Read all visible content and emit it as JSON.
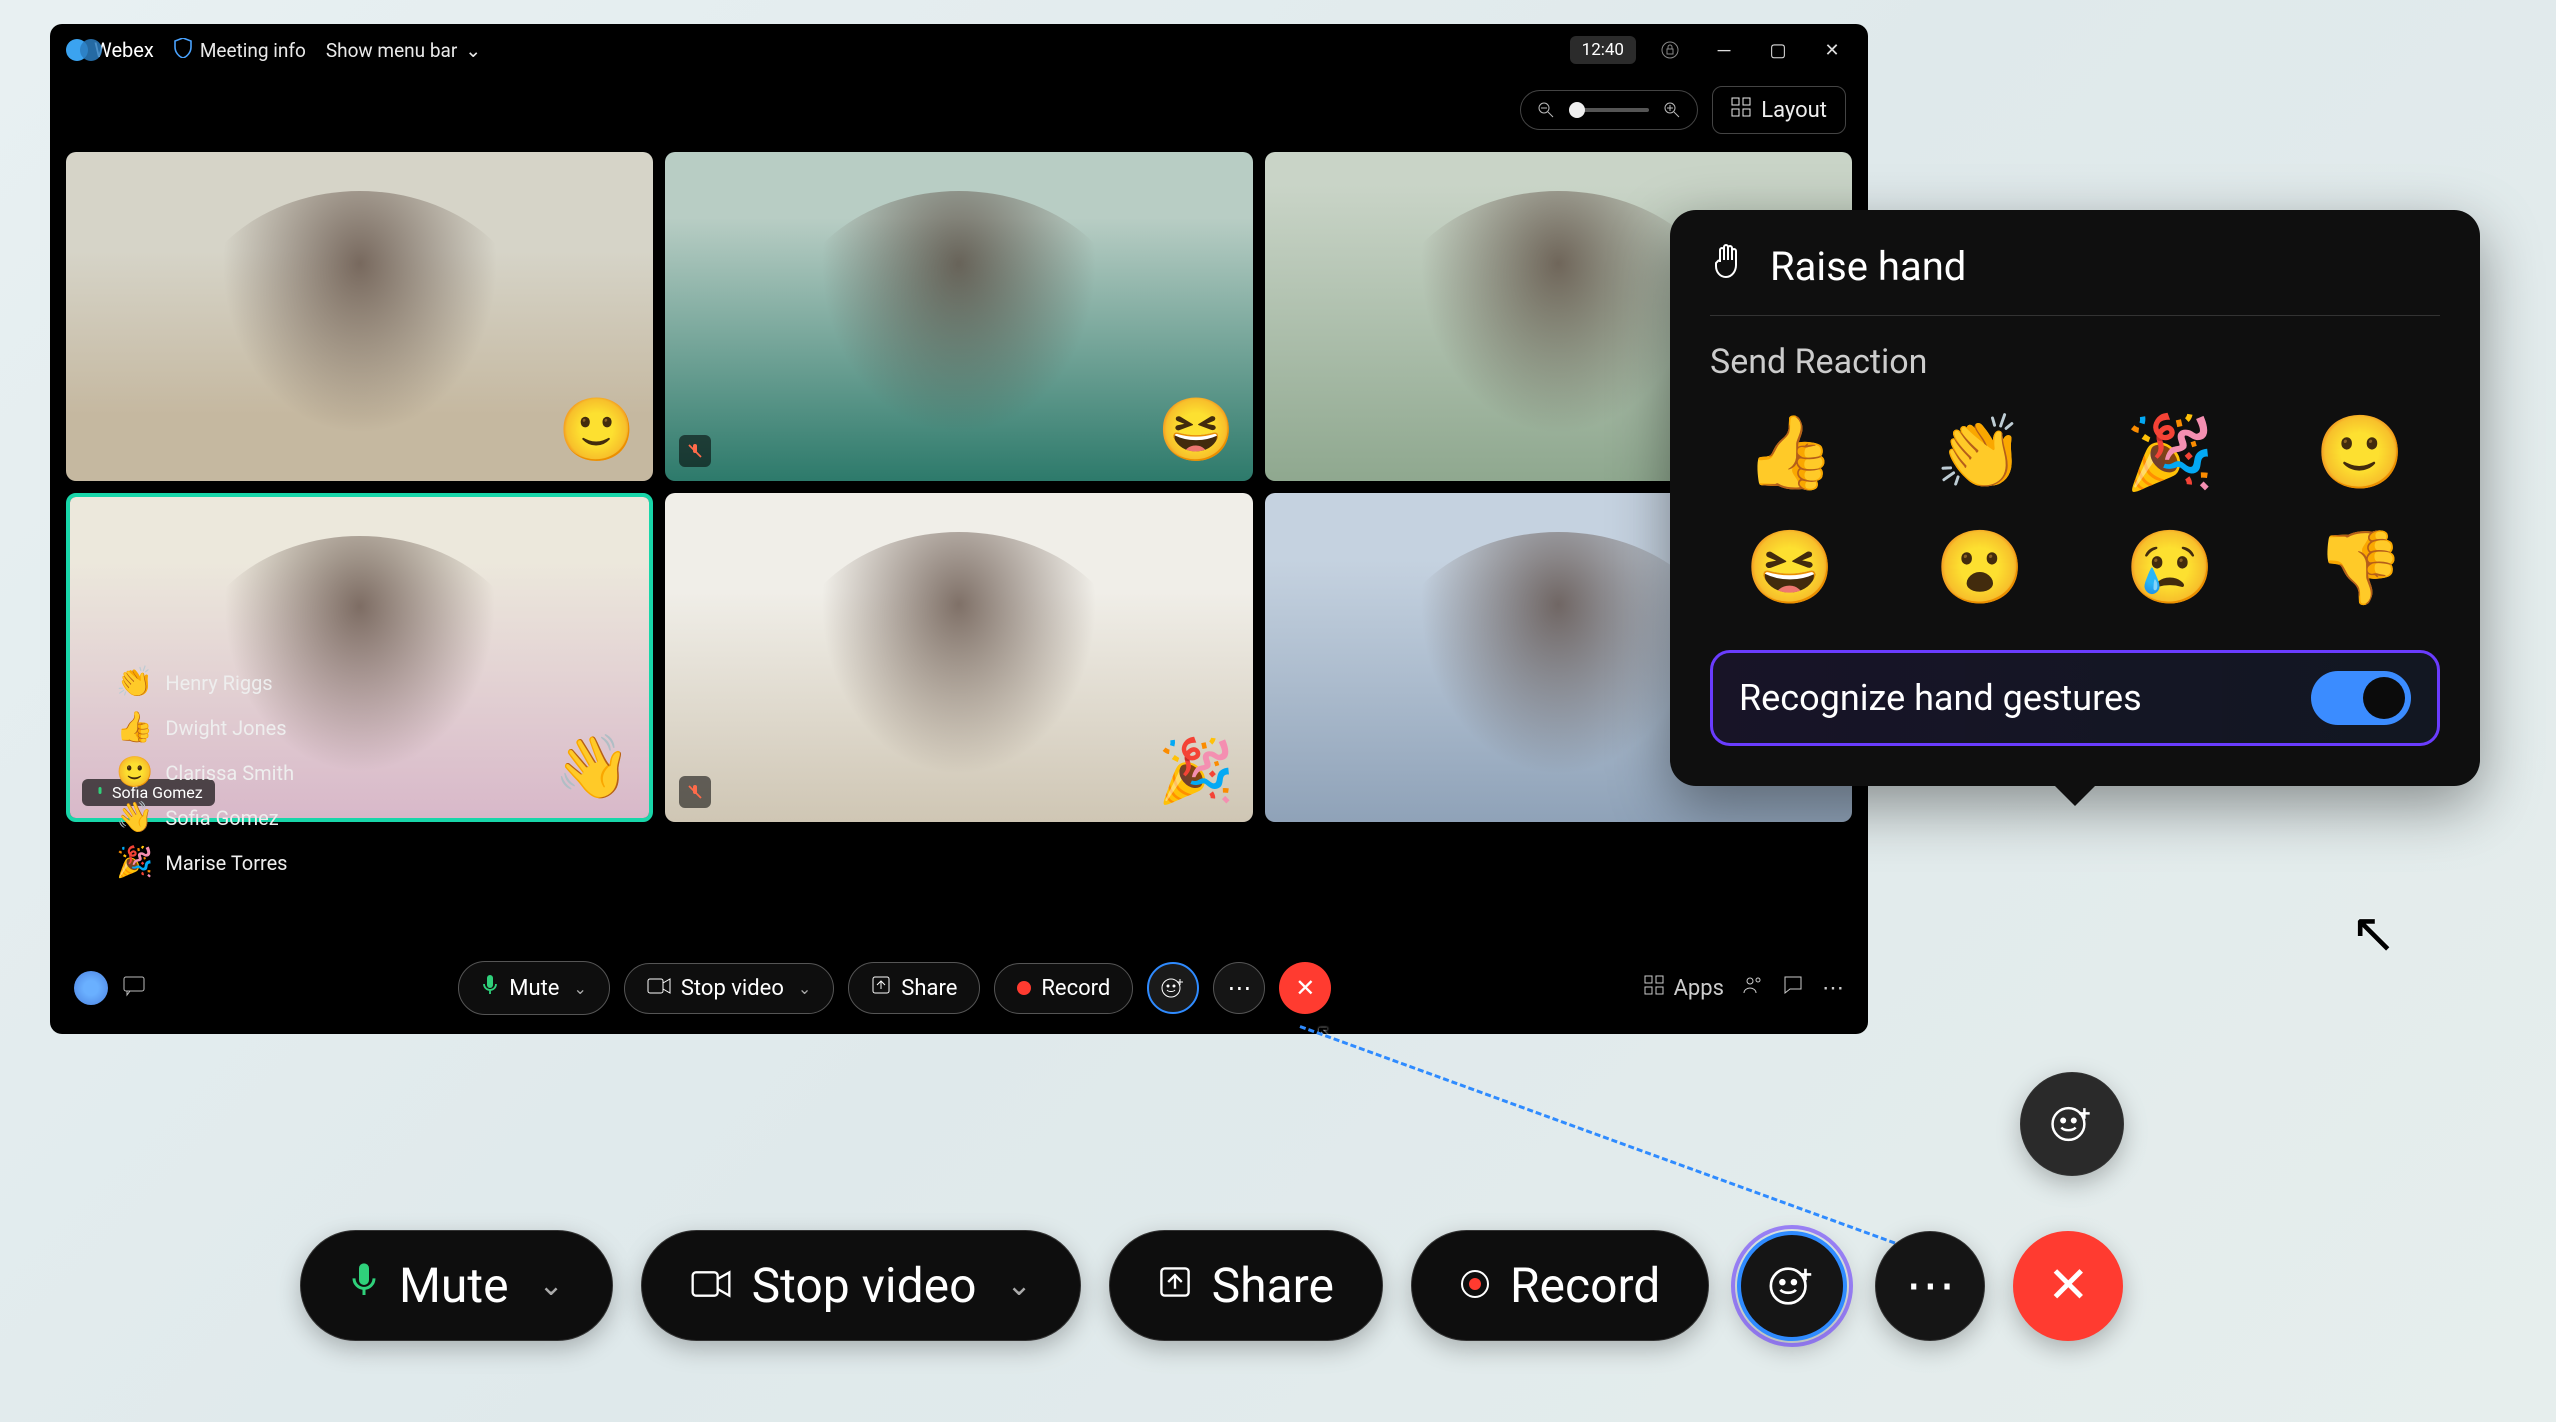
{
  "app": {
    "name": "Webex"
  },
  "titlebar": {
    "meeting_info": "Meeting info",
    "menubar": "Show menu bar",
    "clock": "12:40"
  },
  "top": {
    "layout": "Layout"
  },
  "tiles": [
    {
      "emoji": "🙂",
      "muted": false,
      "active": false
    },
    {
      "emoji": "😆",
      "muted": true,
      "active": false
    },
    {
      "emoji": "",
      "muted": false,
      "active": false
    },
    {
      "emoji": "👋",
      "muted": false,
      "active": true,
      "self_name": "Sofia Gomez"
    },
    {
      "emoji": "🎉",
      "muted": true,
      "active": false
    },
    {
      "emoji": "",
      "muted": false,
      "active": false
    }
  ],
  "reaction_feed": [
    {
      "emoji": "👏",
      "name": "Henry Riggs"
    },
    {
      "emoji": "👍",
      "name": "Dwight Jones"
    },
    {
      "emoji": "🙂",
      "name": "Clarissa Smith"
    },
    {
      "emoji": "👋",
      "name": "Sofia Gomez"
    },
    {
      "emoji": "🎉",
      "name": "Marise Torres"
    }
  ],
  "bottombar": {
    "mute": "Mute",
    "stop_video": "Stop video",
    "share": "Share",
    "record": "Record",
    "apps": "Apps"
  },
  "popup": {
    "raise_hand": "Raise hand",
    "send_reaction": "Send Reaction",
    "emojis": [
      "👍",
      "👏",
      "🎉",
      "🙂",
      "😆",
      "😮",
      "😢",
      "👎"
    ],
    "gesture_label": "Recognize hand gestures",
    "gesture_on": true
  },
  "zoomed": {
    "mute": "Mute",
    "stop_video": "Stop video",
    "share": "Share",
    "record": "Record"
  }
}
